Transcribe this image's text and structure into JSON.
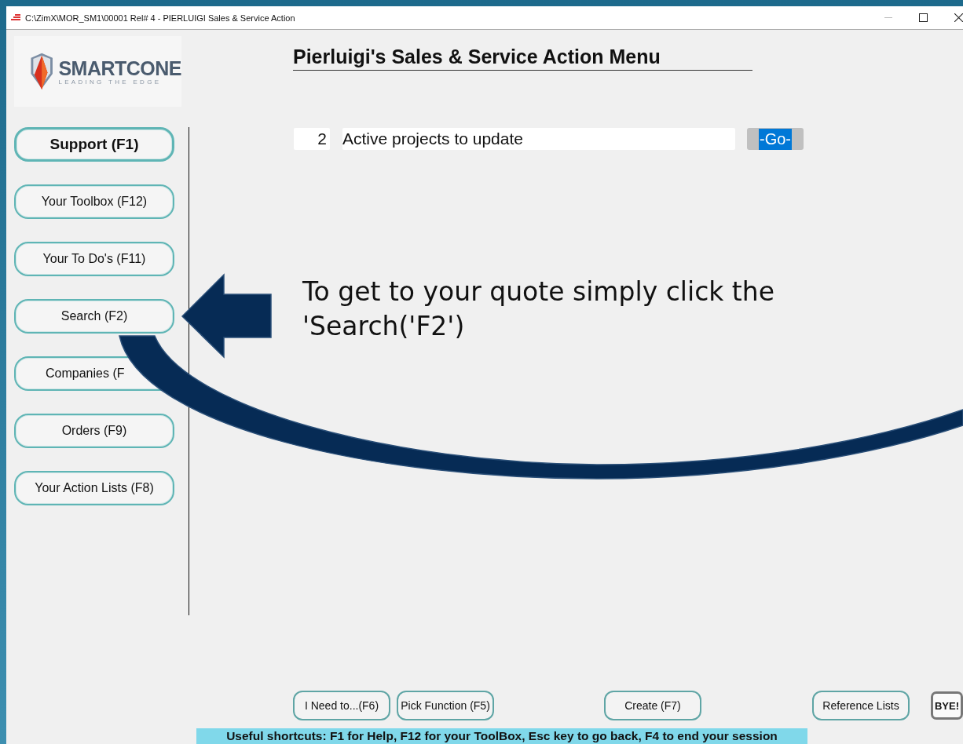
{
  "window": {
    "title": "C:\\ZimX\\MOR_SM1\\00001 Rel# 4 - PIERLUIGI Sales & Service Action"
  },
  "logo": {
    "name": "SMARTCONE",
    "tagline": "LEADING THE EDGE"
  },
  "page_title": "Pierluigi's Sales & Service Action Menu",
  "sidebar": {
    "buttons": [
      {
        "label": "Support (F1)",
        "is_default": true
      },
      {
        "label": "Your Toolbox (F12)",
        "is_default": false
      },
      {
        "label": "Your To Do's (F11)",
        "is_default": false
      },
      {
        "label": "Search (F2)",
        "is_default": false
      },
      {
        "label": "Companies (F",
        "is_default": false
      },
      {
        "label": "Orders (F9)",
        "is_default": false
      },
      {
        "label": "Your Action Lists (F8)",
        "is_default": false
      }
    ]
  },
  "actions": [
    {
      "count": "2",
      "label": "Active projects to update",
      "button": "-Go-",
      "highlighted": true
    }
  ],
  "callout": {
    "text": "To get to your quote simply click the 'Search('F2')"
  },
  "footer_buttons": [
    {
      "label": "I Need to...(F6)",
      "kind": "normal"
    },
    {
      "label": "Pick Function (F5)",
      "kind": "normal"
    },
    {
      "label": "Create (F7)",
      "kind": "normal"
    },
    {
      "label": "Reference Lists",
      "kind": "normal"
    },
    {
      "label": "BYE!",
      "kind": "exit"
    }
  ],
  "status_bar": "Useful shortcuts: F1 for Help, F12 for your ToolBox, Esc key to go back, F4 to end your session"
}
